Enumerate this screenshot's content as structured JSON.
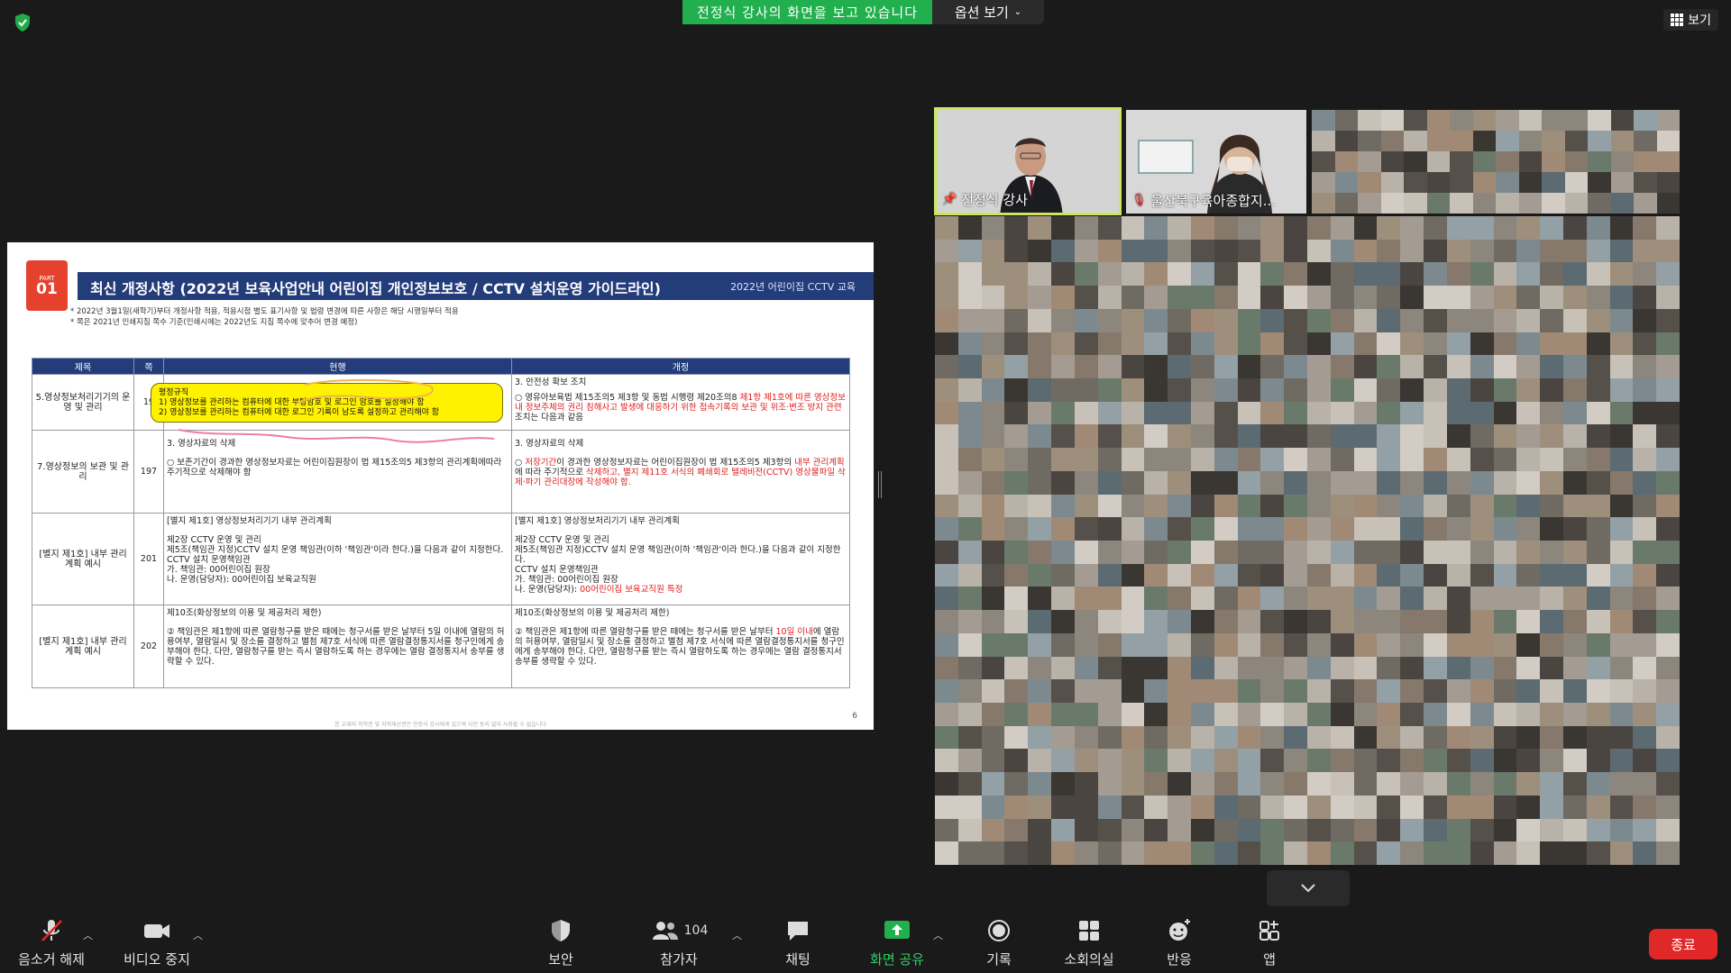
{
  "banner": {
    "sharing_text": "전정식 강사의 화면을 보고 있습니다",
    "options_label": "옵션 보기"
  },
  "view_button": {
    "label": "보기"
  },
  "slide": {
    "part_label": "PART",
    "part_number": "01",
    "title": "최신 개정사항 (2022년 보육사업안내 어린이집 개인정보보호 / CCTV 설치운영 가이드라인)",
    "header_right": "2022년 어린이집 CCTV 교육",
    "note1": "* 2022년 3월1일(새학기)부터 개정사항 적용, 적용시점 별도 표기사항 및 법령 변경에 따른 사항은 해당 시행일부터 적용",
    "note2": "* 쪽은 2021년 인쇄지침 쪽수 기준(인쇄시에는 2022년도 지침 쪽수에 맞추어 변경 예정)",
    "columns": {
      "title": "제목",
      "page": "쪽",
      "now": "현행",
      "revised": "개정"
    },
    "rows": [
      {
        "title": "5.영상정보처리기기의 운영 및 관리",
        "page": "19",
        "now": "",
        "revised_head": "3. 안전성 확보 조치",
        "revised_a": "○ 영유아보육법 제15조의5 제3항 및 동법 시행령 제20조의8 ",
        "revised_red": "제1항 제1호에 따른 영상정보 내 정보주체의 권리 침해사고 발생에 대응하기 위한 접속기록의 보관 및 위조·변조 방지 관련",
        "revised_b": " 조치는 다음과 같음"
      },
      {
        "title": "7.영상정보의 보관 및 관리",
        "page": "197",
        "now_head": "3. 영상자료의 삭제",
        "now": "○ 보존기간이 경과한 영상정보자료는 어린이집원장이 법 제15조의5 제3항의 관리계획에따라 주기적으로 삭제해야 함",
        "revised_head": "3. 영상자료의 삭제",
        "revised_a": "○ ",
        "revised_red1": "저장기간",
        "revised_b": "이 경과한 영상정보자료는 어린이집원장이 법 제15조의5 제3항의 ",
        "revised_red2": "내부 관리계획",
        "revised_c": "에 따라 주기적으로 ",
        "revised_red3": "삭제하고, 별지 제11호 서식의 폐쇄회로 텔레비전(CCTV) 영상물파일 삭제·파기 관리대장에 작성해야 함."
      },
      {
        "title": "[별지 제1호] 내부 관리계획 예시",
        "page": "201",
        "now_head": "[별지 제1호] 영상정보처리기기 내부 관리계획",
        "now": "제2장 CCTV 운영 및 관리\n제5조(책임관 지정)CCTV 설치 운영 책임관(이하 '책임관'이라 한다.)을 다음과 같이 지정한다.\nCCTV 설치 운영책임관\n가. 책임관: 00어린이집 원장\n나. 운영(담당자): 00어린이집 보육교직원",
        "revised_head": "[별지 제1호] 영상정보처리기기 내부 관리계획",
        "revised_a": "제2장 CCTV 운영 및 관리\n제5조(책임관 지정)CCTV 설치 운영 책임관(이하 '책임관'이라 한다.)을 다음과 같이 지정한다.\nCCTV 설치 운영책임관\n가. 책임관: 00어린이집 원장\n나. 운영(담당자): ",
        "revised_red": "00어린이집 보육교직원 특정"
      },
      {
        "title": "[별지 제1호] 내부 관리계획 예시",
        "page": "202",
        "now_head": "제10조(화상정보의 이용 및 제공처리 제한)",
        "now": "② 책임관은 제1항에 따른 열람청구를 받은 때에는 청구서를 받은 날부터 5일 이내에 열람의 허용여부, 열람일시 및 장소를 결정하고 별첨 제7호 서식에 따른 열람결정통지서를 청구인에게 송부해야 한다. 다만, 열람청구를 받는 즉시 열람하도록 하는 경우에는 열람 결정통지서 송부를 생략할 수 있다.",
        "revised_head": "제10조(화상정보의 이용 및 제공처리 제한)",
        "revised_a": "② 책임관은 제1항에 따른 열람청구를 받은 때에는 청구서를 받은 날부터 ",
        "revised_red": "10일 이내",
        "revised_b": "에 열람의 허용여부, 열람일시 및 장소를 결정하고 별첨 제7호 서식에 따른 열람결정통지서를 청구인에게 송부해야 한다. 다만, 열람청구를 받는 즉시 열람하도록 하는 경우에는 열람 결정통지서 송부를 생략할 수 있다."
      }
    ],
    "bubble_title": "평정규직",
    "bubble_line1": "1) 영상정보를 관리하는 컴퓨터에 대한 부팅암호 및 로그인 암호를 설정해야 함",
    "bubble_line2": "2) 영상정보를 관리하는 컴퓨터에 대한 로그인 기록이 남도록 설정하고 관리해야 함",
    "page_number": "6",
    "copyright": "본 교재의 저작권 및 지적재산권은 전정식 강사에게 있으며 사전 동의 없이 사용할 수 없습니다"
  },
  "participants": {
    "presenter_name": "전정식 강사",
    "second_name": "울산북구육아종합지..."
  },
  "toolbar": {
    "mute": "음소거 해제",
    "video": "비디오 중지",
    "security": "보안",
    "participants": "참가자",
    "participant_count": "104",
    "chat": "채팅",
    "share": "화면 공유",
    "record": "기록",
    "breakout": "소회의실",
    "reactions": "반응",
    "apps": "앱",
    "end": "종료"
  },
  "colors": {
    "share_green": "#21b04d",
    "end_red": "#e02828",
    "active_speaker": "#c9e85b",
    "slide_navy": "#233c7a"
  }
}
